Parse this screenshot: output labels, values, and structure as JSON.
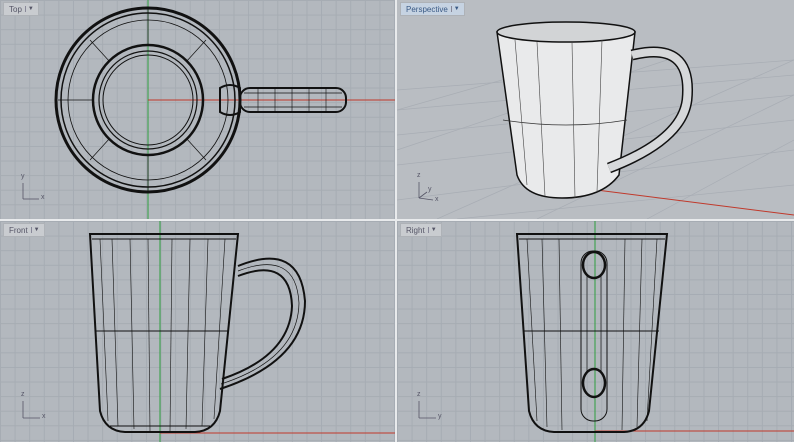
{
  "viewports": [
    {
      "name": "Top",
      "axes": [
        "y",
        "x"
      ],
      "active": false
    },
    {
      "name": "Perspective",
      "axes": [
        "z",
        "y",
        "x"
      ],
      "active": true
    },
    {
      "name": "Front",
      "axes": [
        "z",
        "x"
      ],
      "active": false
    },
    {
      "name": "Right",
      "axes": [
        "z",
        "y"
      ],
      "active": false
    }
  ],
  "dropdown_icon": "caret-down-icon",
  "colors": {
    "x_axis": "#c0392b",
    "y_axis": "#2e9e3e",
    "background": "#b3b8be",
    "curve": "#1a1a1a"
  }
}
